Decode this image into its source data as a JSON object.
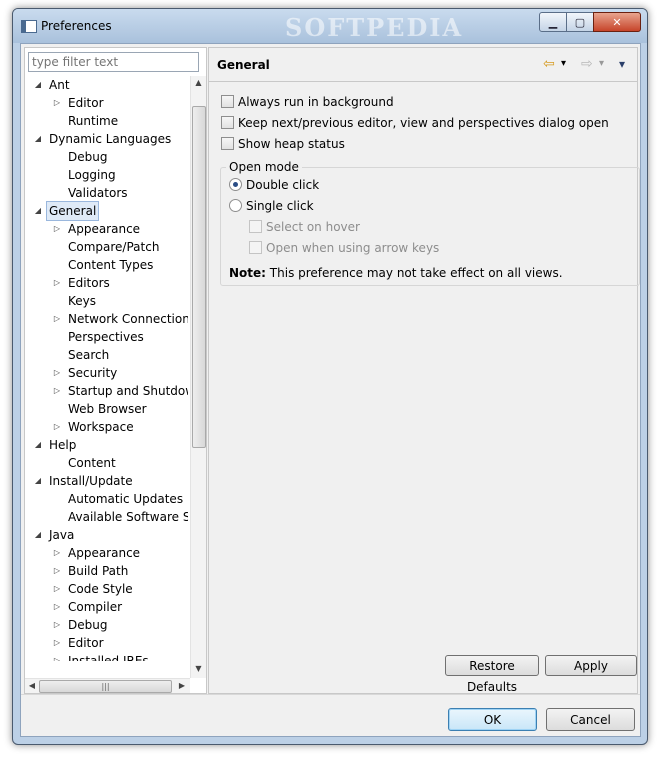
{
  "window": {
    "title": "Preferences",
    "watermark": "SOFTPEDIA",
    "controls": {
      "minimize": "▁",
      "maximize": "▢",
      "close": "✕"
    }
  },
  "filter": {
    "placeholder": "type filter text"
  },
  "tree": [
    {
      "label": "Ant",
      "level": 0,
      "state": "expanded"
    },
    {
      "label": "Editor",
      "level": 1,
      "state": "collapsed"
    },
    {
      "label": "Runtime",
      "level": 1,
      "state": "leaf"
    },
    {
      "label": "Dynamic Languages",
      "level": 0,
      "state": "expanded"
    },
    {
      "label": "Debug",
      "level": 1,
      "state": "leaf"
    },
    {
      "label": "Logging",
      "level": 1,
      "state": "leaf"
    },
    {
      "label": "Validators",
      "level": 1,
      "state": "leaf"
    },
    {
      "label": "General",
      "level": 0,
      "state": "expanded",
      "selected": true
    },
    {
      "label": "Appearance",
      "level": 1,
      "state": "collapsed"
    },
    {
      "label": "Compare/Patch",
      "level": 1,
      "state": "leaf"
    },
    {
      "label": "Content Types",
      "level": 1,
      "state": "leaf"
    },
    {
      "label": "Editors",
      "level": 1,
      "state": "collapsed"
    },
    {
      "label": "Keys",
      "level": 1,
      "state": "leaf"
    },
    {
      "label": "Network Connection",
      "level": 1,
      "state": "collapsed"
    },
    {
      "label": "Perspectives",
      "level": 1,
      "state": "leaf"
    },
    {
      "label": "Search",
      "level": 1,
      "state": "leaf"
    },
    {
      "label": "Security",
      "level": 1,
      "state": "collapsed"
    },
    {
      "label": "Startup and Shutdow",
      "level": 1,
      "state": "collapsed"
    },
    {
      "label": "Web Browser",
      "level": 1,
      "state": "leaf"
    },
    {
      "label": "Workspace",
      "level": 1,
      "state": "collapsed"
    },
    {
      "label": "Help",
      "level": 0,
      "state": "expanded"
    },
    {
      "label": "Content",
      "level": 1,
      "state": "leaf"
    },
    {
      "label": "Install/Update",
      "level": 0,
      "state": "expanded"
    },
    {
      "label": "Automatic Updates",
      "level": 1,
      "state": "leaf"
    },
    {
      "label": "Available Software S",
      "level": 1,
      "state": "leaf"
    },
    {
      "label": "Java",
      "level": 0,
      "state": "expanded"
    },
    {
      "label": "Appearance",
      "level": 1,
      "state": "collapsed"
    },
    {
      "label": "Build Path",
      "level": 1,
      "state": "collapsed"
    },
    {
      "label": "Code Style",
      "level": 1,
      "state": "collapsed"
    },
    {
      "label": "Compiler",
      "level": 1,
      "state": "collapsed"
    },
    {
      "label": "Debug",
      "level": 1,
      "state": "collapsed"
    },
    {
      "label": "Editor",
      "level": 1,
      "state": "collapsed"
    },
    {
      "label": "Installed JREs",
      "level": 1,
      "state": "collapsed"
    }
  ],
  "page": {
    "title": "General",
    "nav": {
      "back": "⇦",
      "back_menu": "▾",
      "forward": "⇨",
      "forward_menu": "▾",
      "view_menu": "▾"
    },
    "options": [
      {
        "label": "Always run in background",
        "checked": false
      },
      {
        "label": "Keep next/previous editor, view and perspectives dialog open",
        "checked": false
      },
      {
        "label": "Show heap status",
        "checked": false
      }
    ],
    "open_mode": {
      "label": "Open mode",
      "double_click": "Double click",
      "single_click": "Single click",
      "select_on_hover": "Select on hover",
      "open_arrow_keys": "Open when using arrow keys",
      "selected": "double_click"
    },
    "note_label": "Note:",
    "note_text": "This preference may not take effect on all views."
  },
  "buttons": {
    "restore_defaults": "Restore Defaults",
    "apply": "Apply",
    "ok": "OK",
    "cancel": "Cancel"
  },
  "colors": {
    "accent": "#3c7fb1",
    "selection": "#dfeaf7",
    "frame": "#bcd0e6"
  }
}
